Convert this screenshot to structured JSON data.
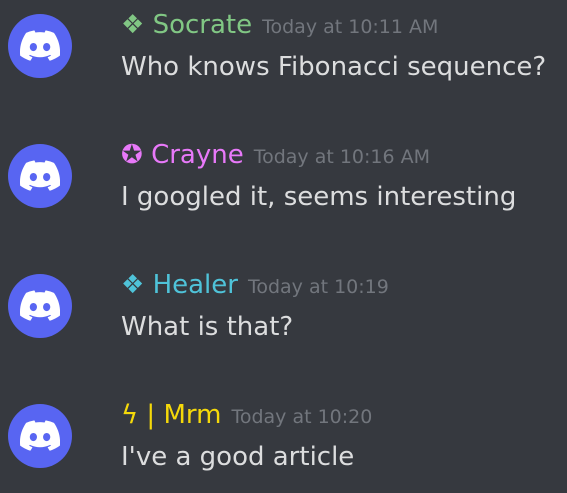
{
  "colors": {
    "background": "#36393f",
    "avatar_bg": "#5865f2",
    "timestamp": "#72767d",
    "message_text": "#dcddde"
  },
  "messages": [
    {
      "author_badge": "❖",
      "author_name": "Socrate",
      "author_color": "#81c784",
      "timestamp": "Today at 10:11 AM",
      "text": "Who knows Fibonacci sequence?",
      "avatar_icon": "discord-logo-icon"
    },
    {
      "author_badge": "✪",
      "author_name": "Crayne",
      "author_color": "#e879f9",
      "timestamp": "Today at 10:16 AM",
      "text": "I googled it, seems interesting",
      "avatar_icon": "discord-logo-icon"
    },
    {
      "author_badge": "❖",
      "author_name": "Healer",
      "author_color": "#4fc3d9",
      "timestamp": "Today at 10:19",
      "text": "What is that?",
      "avatar_icon": "discord-logo-icon"
    },
    {
      "author_badge": "ϟ |",
      "author_name": "Mrm",
      "author_color": "#f5d90a",
      "timestamp": "Today at 10:20",
      "text": "I've a good article",
      "avatar_icon": "discord-logo-icon"
    }
  ]
}
